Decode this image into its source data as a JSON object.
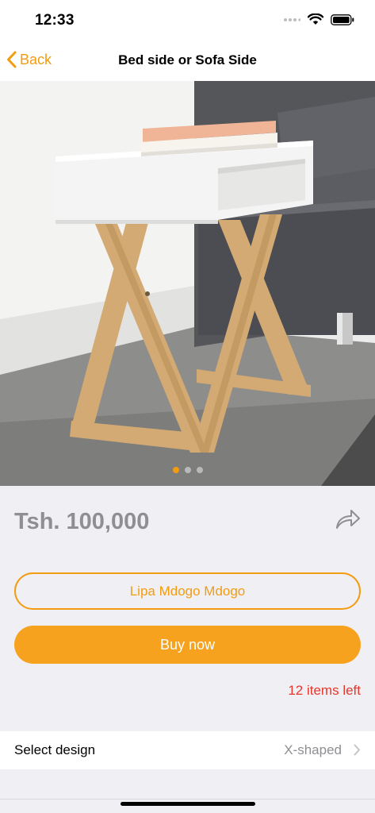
{
  "status": {
    "time": "12:33"
  },
  "nav": {
    "back_label": "Back",
    "title": "Bed side or Sofa Side"
  },
  "carousel": {
    "image": "side-table-photo",
    "page_count": 3,
    "active_index": 0
  },
  "product": {
    "price": "Tsh. 100,000",
    "installment_button": "Lipa Mdogo Mdogo",
    "buy_button": "Buy now",
    "stock_text": "12 items left"
  },
  "design": {
    "label": "Select design",
    "value": "X-shaped"
  },
  "colors": {
    "accent": "#f39c12",
    "stock_red": "#e8362a",
    "price_gray": "#8e8e93",
    "background": "#efeff4"
  },
  "icons": [
    "signal-icon",
    "wifi-icon",
    "battery-icon",
    "chevron-left-icon",
    "share-icon",
    "chevron-right-icon"
  ]
}
